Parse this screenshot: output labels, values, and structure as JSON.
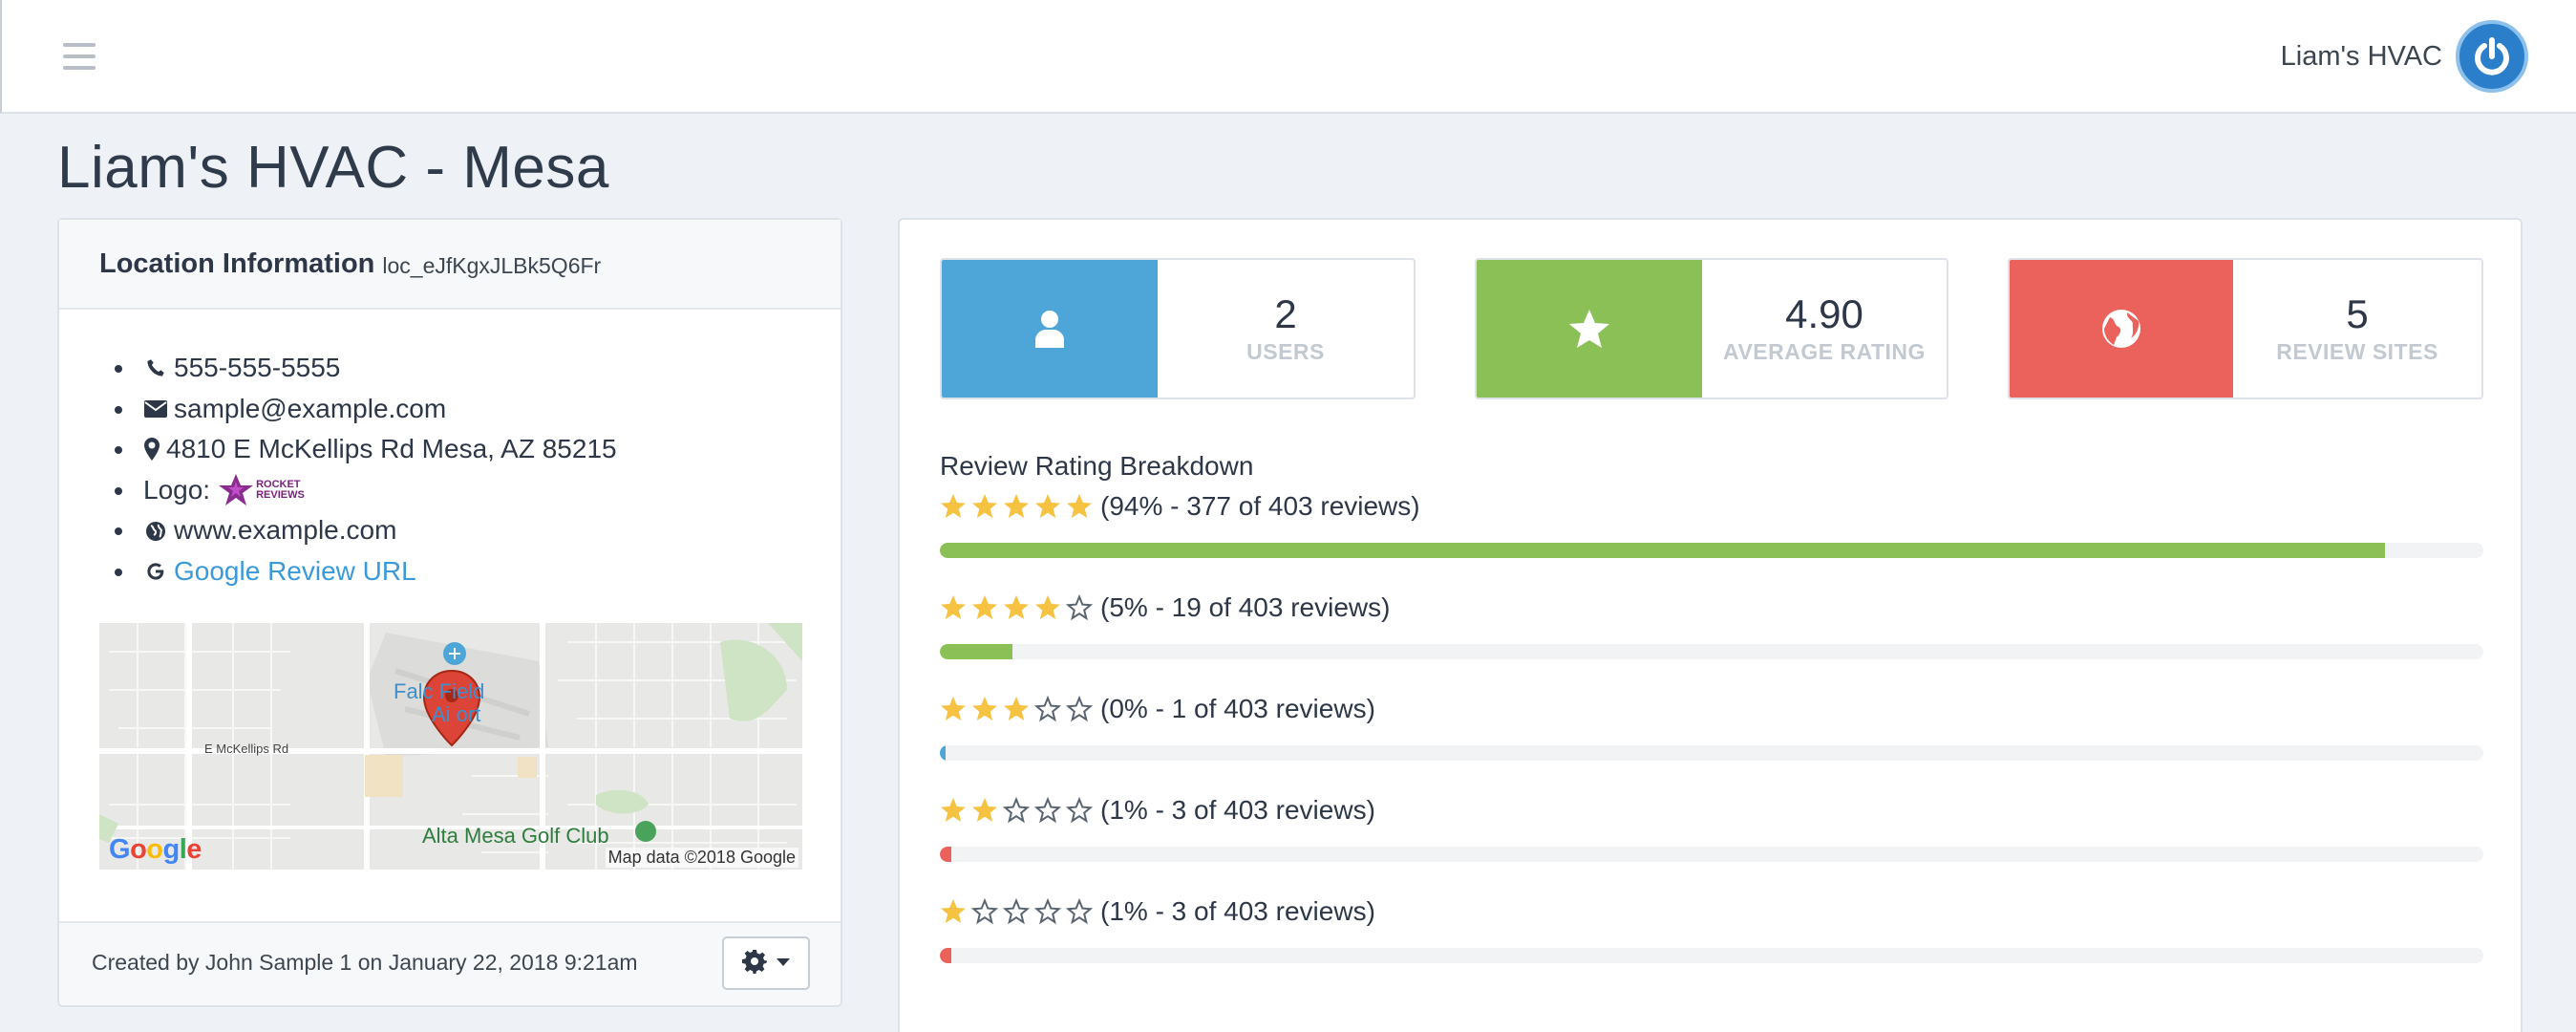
{
  "nav": {
    "username": "Liam's HVAC"
  },
  "page": {
    "title": "Liam's HVAC - Mesa"
  },
  "location": {
    "header_title": "Location Information",
    "location_id": "loc_eJfKgxJLBk5Q6Fr",
    "phone": "555-555-5555",
    "email": "sample@example.com",
    "address": "4810 E McKellips Rd Mesa, AZ 85215",
    "logo_label": "Logo:",
    "logo_text_1": "ROCKET",
    "logo_text_2": "REVIEWS",
    "website": "www.example.com",
    "google_review_label": "Google Review URL",
    "map": {
      "street": "E McKellips Rd",
      "place": "Falcon Field Airport",
      "place_line1": "Falc  Field",
      "place_line2": "Ai   ort",
      "golf": "Alta Mesa Golf Club",
      "credit": "Map data ©2018 Google",
      "brand": "Google"
    },
    "created_text": "Created by John Sample 1 on January 22, 2018 9:21am"
  },
  "stats": [
    {
      "value": "2",
      "label": "USERS",
      "icon": "user-icon",
      "color": "#4ea6d8"
    },
    {
      "value": "4.90",
      "label": "AVERAGE RATING",
      "icon": "star-icon",
      "color": "#8bc056"
    },
    {
      "value": "5",
      "label": "REVIEW SITES",
      "icon": "globe-icon",
      "color": "#ea625b"
    }
  ],
  "breakdown": {
    "title": "Review Rating Breakdown",
    "rows": [
      {
        "stars": 5,
        "text": "(94% - 377 of 403 reviews)",
        "percent": 93.6,
        "color": "#8bc056"
      },
      {
        "stars": 4,
        "text": "(5% - 19 of 403 reviews)",
        "percent": 4.7,
        "color": "#8bc056"
      },
      {
        "stars": 3,
        "text": "(0% - 1 of 403 reviews)",
        "percent": 0.25,
        "color": "#4ea6d8"
      },
      {
        "stars": 2,
        "text": "(1% - 3 of 403 reviews)",
        "percent": 0.75,
        "color": "#ea625b"
      },
      {
        "stars": 1,
        "text": "(1% - 3 of 403 reviews)",
        "percent": 0.75,
        "color": "#ea625b"
      }
    ]
  },
  "colors": {
    "star": "#f5c242",
    "star_empty": "#5a6470",
    "accent_blue": "#2b7ec9",
    "link": "#3a9ad9"
  }
}
